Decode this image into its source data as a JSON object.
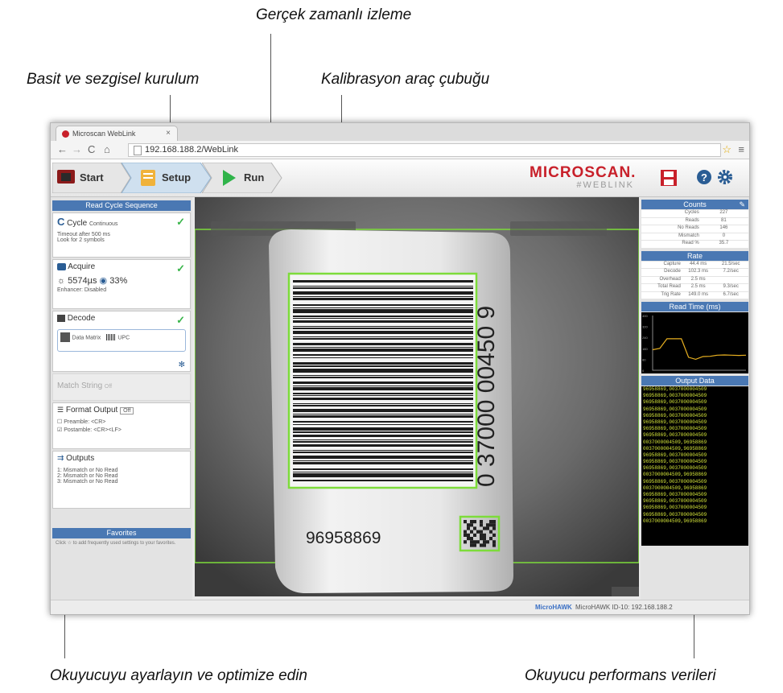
{
  "callouts": {
    "realtime": "Gerçek zamanlı izleme",
    "setup": "Basit ve sezgisel kurulum",
    "calibration": "Kalibrasyon araç çubuğu",
    "optimize": "Okuyucuyu ayarlayın ve optimize edin",
    "performance": "Okuyucu performans verileri"
  },
  "browser": {
    "tab_title": "Microscan WebLink",
    "url": "192.168.188.2/WebLink"
  },
  "toolbar": {
    "start": "Start",
    "setup": "Setup",
    "run": "Run",
    "logo_main": "MICROSCAN.",
    "logo_sub": "#WEBLINK"
  },
  "left": {
    "title": "Read Cycle Sequence",
    "cycle": {
      "label": "Cycle",
      "mode": "Continuous",
      "timeout": "Timeout after 500 ms",
      "lookfor": "Look for 2 symbols"
    },
    "acquire": {
      "label": "Acquire",
      "exposure": "5574µs",
      "gain": "33%",
      "enhancer": "Enhancer: Disabled"
    },
    "decode": {
      "label": "Decode",
      "sym1": "Data Matrix",
      "sym2": "UPC"
    },
    "match": {
      "label": "Match String",
      "state": "Off"
    },
    "format": {
      "label": "Format Output",
      "toggle": "Off",
      "preamble": "Preamble: <CR>",
      "postamble": "Postamble: <CR><LF>"
    },
    "outputs": {
      "label": "Outputs",
      "o1": "1: Mismatch or No Read",
      "o2": "2: Mismatch or No Read",
      "o3": "3: Mismatch or No Read"
    },
    "favorites": {
      "title": "Favorites",
      "hint": "Click ☆ to add frequently used settings to your favorites."
    }
  },
  "feed": {
    "barcode_number": "96958869",
    "upc_digits": "0 37000 00450 9"
  },
  "right": {
    "counts_title": "Counts",
    "counts": [
      [
        "Cycles",
        "227"
      ],
      [
        "Reads",
        "81"
      ],
      [
        "No Reads",
        "146"
      ],
      [
        "Mismatch",
        "0"
      ],
      [
        "Read %",
        "35.7"
      ]
    ],
    "rate_title": "Rate",
    "rate": [
      [
        "Capture",
        "44.4 ms",
        "21.5/sec"
      ],
      [
        "Decode",
        "102.3 ms",
        "7.2/sec"
      ],
      [
        "Overhead",
        "2.5 ms",
        ""
      ],
      [
        "Total Read",
        "2.5 ms",
        "9.3/sec"
      ],
      [
        "Trig Rate",
        "149.0 ms",
        "6.7/sec"
      ]
    ],
    "readtime_title": "Read Time (ms)",
    "graph_ticks": [
      "400",
      "320",
      "240",
      "160",
      "80",
      "0"
    ],
    "graph_points": [
      150,
      160,
      230,
      230,
      230,
      95,
      80,
      100,
      102,
      110,
      112,
      110,
      108,
      110
    ],
    "output_title": "Output Data",
    "output_rows": [
      "96958869,0037000004509",
      "96958869,0037000004509",
      "96958869,0037000004509",
      "96958869,0037000004509",
      "96958869,0037000004509",
      "96958869,0037000004509",
      "96958869,0037000004509",
      "96958869,0037000004509",
      "0037000004509,96958869",
      "0037000004509,96958869",
      "96958869,0037000004509",
      "96958869,0037000004509",
      "96958869,0037000004509",
      "0037000004509,96958869",
      "96958869,0037000004509",
      "0037000004509,96958869",
      "96958869,0037000004509",
      "96958869,0037000004509",
      "96958869,0037000004509",
      "96958869,0037000004509",
      "0037000004509,96958869"
    ]
  },
  "status": {
    "left": "MicroHAWK",
    "right": "MicroHAWK ID-10: 192.168.188.2"
  },
  "colors": {
    "accent": "#4a78b3",
    "brand": "#c8202a",
    "ok": "#39b54a",
    "highlight": "#7ddc3a",
    "output_text": "#d6e63a"
  }
}
